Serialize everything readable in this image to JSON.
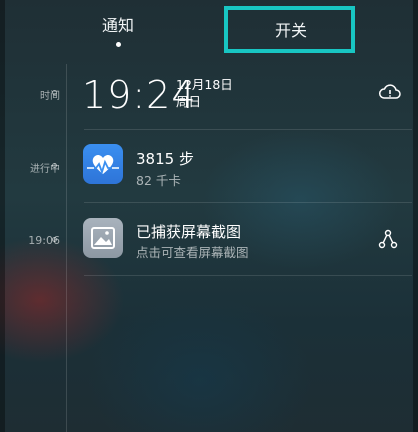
{
  "tabs": {
    "notify_label": "通知",
    "switch_label": "开关"
  },
  "timeline": {
    "label_time": "时间",
    "label_ongoing": "进行中",
    "label_1906": "19:06"
  },
  "clock": {
    "time": "19:24",
    "date": "12月18日",
    "weekday": "周日",
    "weather_icon": "cloud-alert-icon"
  },
  "health": {
    "icon": "heart-pulse-icon",
    "steps": "3815 步",
    "calories": "82 千卡"
  },
  "screenshot": {
    "icon": "gallery-image-icon",
    "title": "已捕获屏幕截图",
    "subtitle": "点击可查看屏幕截图",
    "action_icon": "share-icon"
  },
  "colors": {
    "highlight": "#18c6c3",
    "health_icon": "#3a8ff0"
  }
}
